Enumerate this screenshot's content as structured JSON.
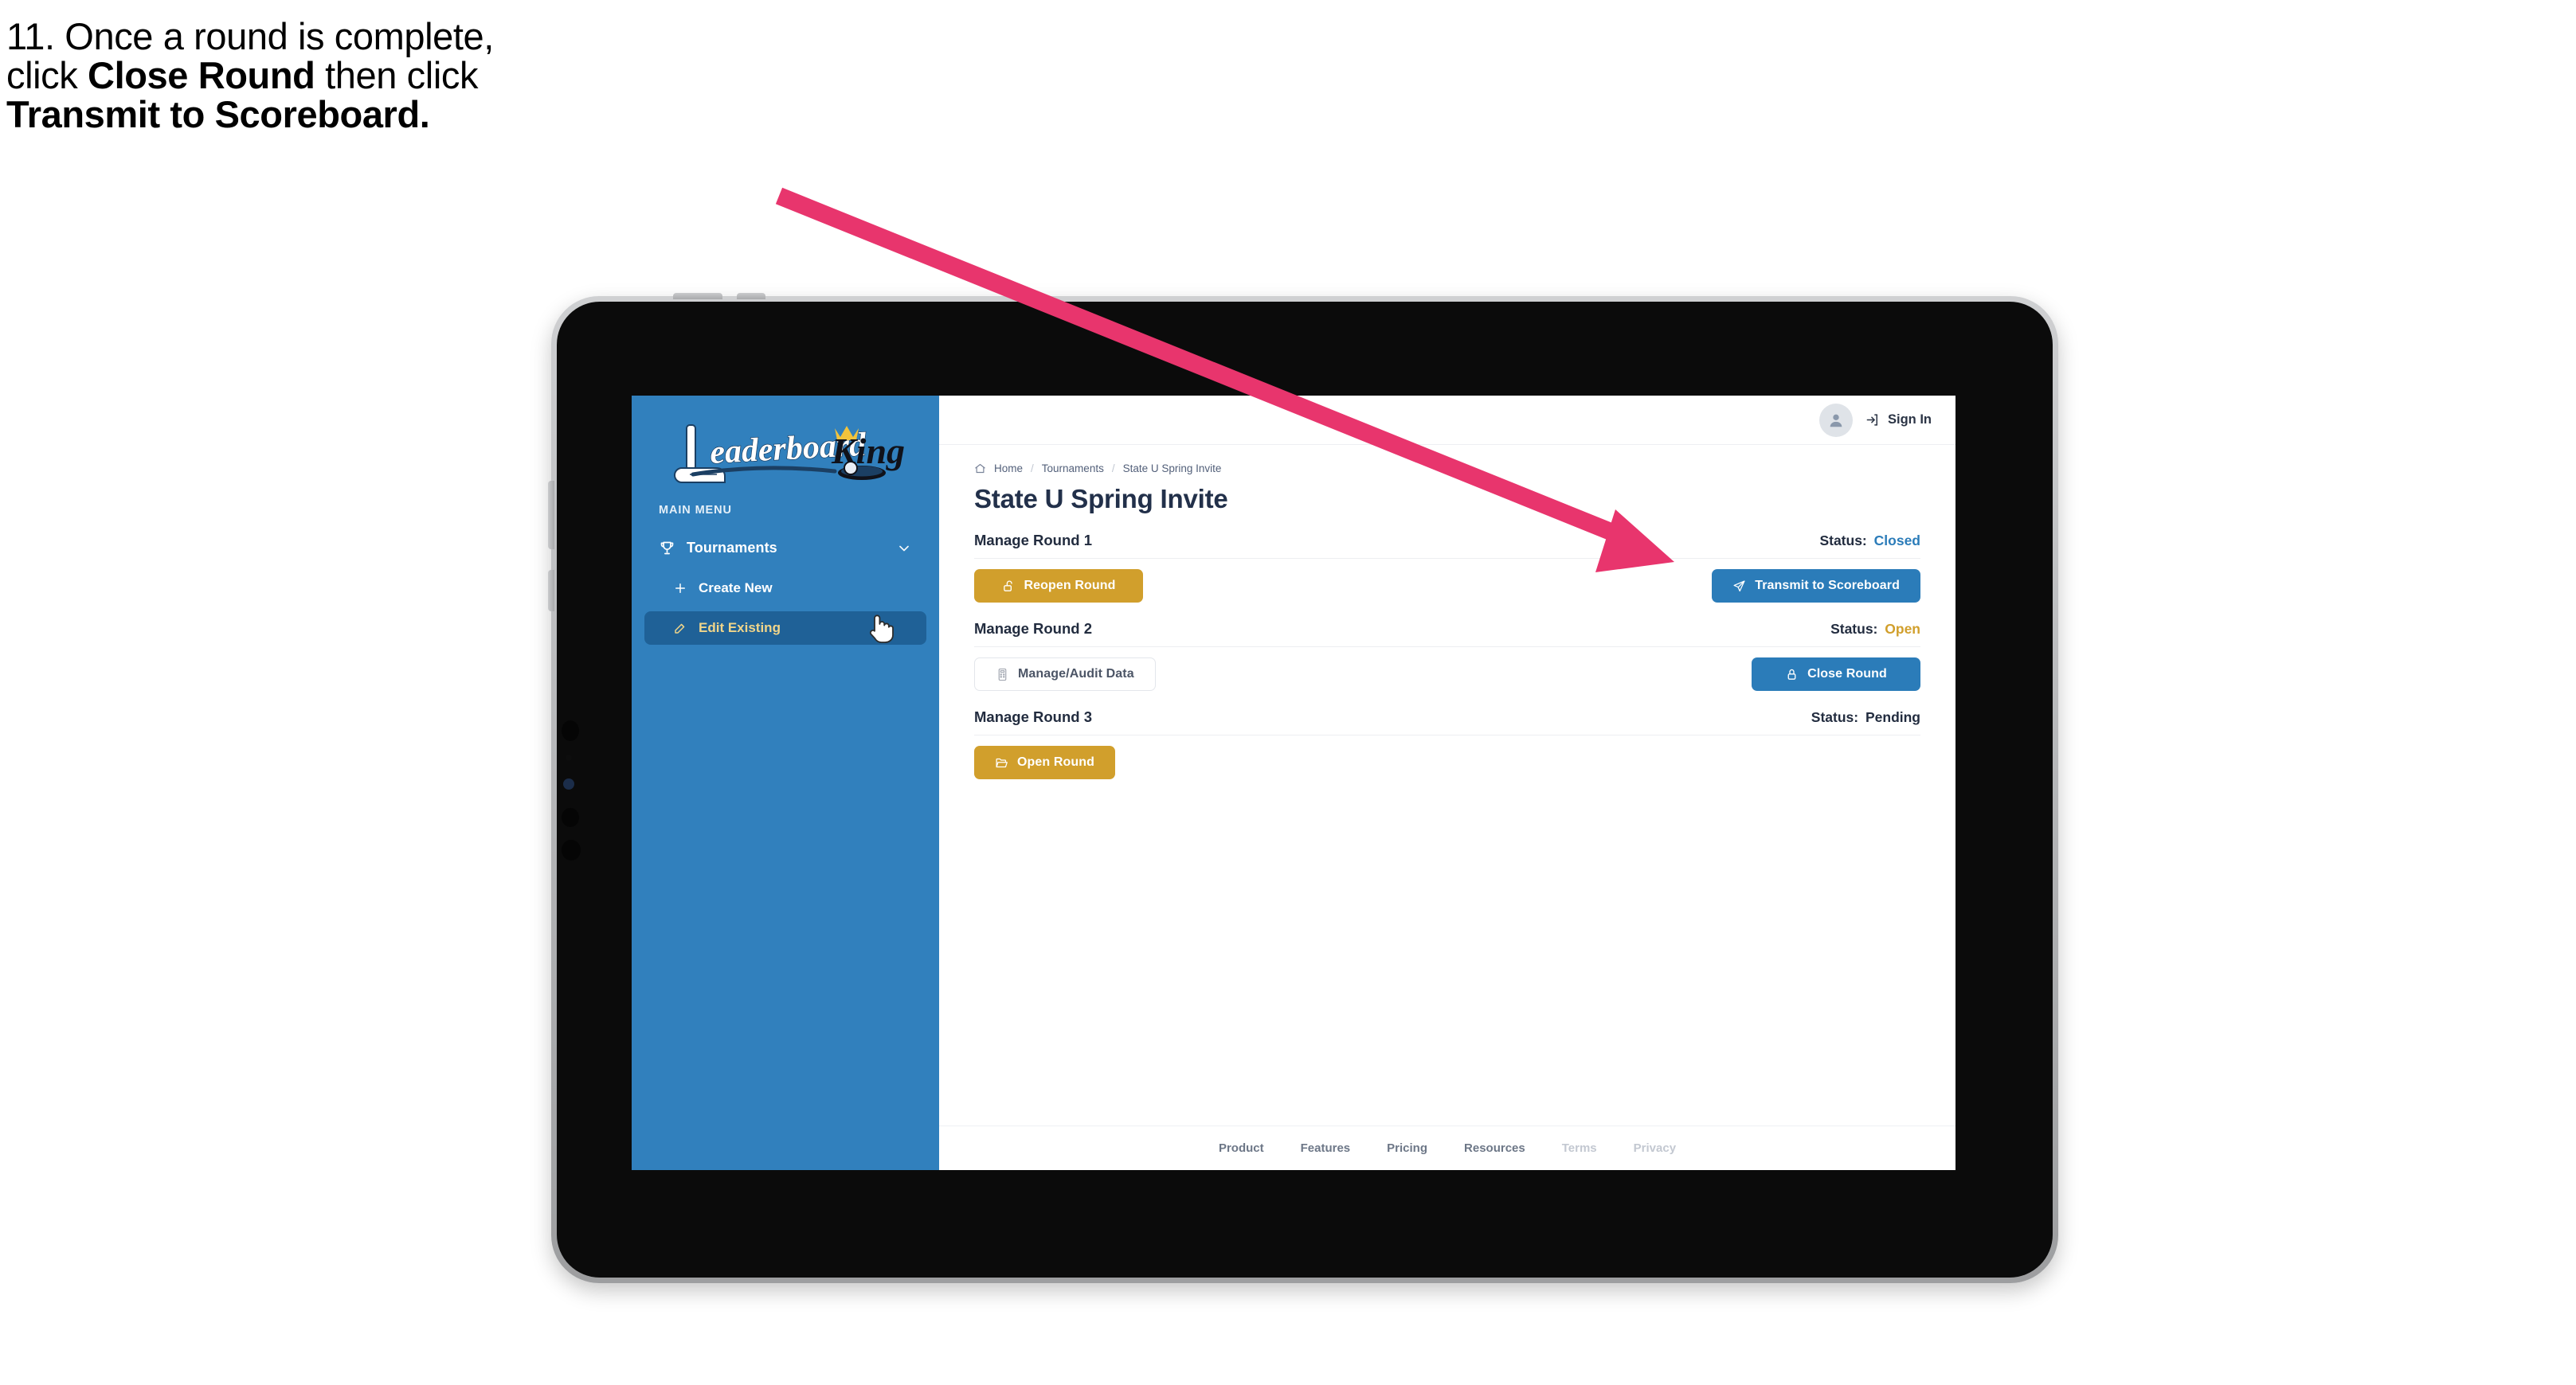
{
  "caption": {
    "line1": "11. Once a round is complete,",
    "line2_a": "click ",
    "line2_b": "Close Round",
    "line2_c": " then click",
    "line3": "Transmit to Scoreboard."
  },
  "annotation": {
    "arrow_color": "#E8356D",
    "points_to": "Transmit to Scoreboard"
  },
  "sidebar": {
    "logo_primary": "Leaderboard",
    "logo_secondary": "King",
    "section_label": "MAIN MENU",
    "items": [
      {
        "label": "Tournaments",
        "icon": "trophy-icon",
        "expand_icon": "chevron-down-icon",
        "active": false
      },
      {
        "label": "Create New",
        "icon": "plus-icon",
        "active": false
      },
      {
        "label": "Edit Existing",
        "icon": "edit-pencil-icon",
        "active": true
      }
    ],
    "bg_color": "#3180BD",
    "active_bg_color": "#1F6197",
    "active_text_color": "#F0D58A"
  },
  "topbar": {
    "avatar_icon": "user-avatar-icon",
    "signin_icon": "sign-in-arrow-icon",
    "signin_label": "Sign In"
  },
  "breadcrumb": {
    "home_icon": "home-icon",
    "items": [
      "Home",
      "Tournaments",
      "State U Spring Invite"
    ],
    "separator": "/"
  },
  "page": {
    "title": "State U Spring Invite"
  },
  "rounds": [
    {
      "name": "Manage Round 1",
      "status_label": "Status:",
      "status_value": "Closed",
      "status_color": "#2B7CB9",
      "left_button": {
        "label": "Reopen Round",
        "icon": "unlock-icon",
        "style": "gold"
      },
      "right_button": {
        "label": "Transmit to Scoreboard",
        "icon": "paper-plane-icon",
        "style": "blue"
      }
    },
    {
      "name": "Manage Round 2",
      "status_label": "Status:",
      "status_value": "Open",
      "status_color": "#D19F2C",
      "left_button": {
        "label": "Manage/Audit Data",
        "icon": "calculator-icon",
        "style": "ghost"
      },
      "right_button": {
        "label": "Close Round",
        "icon": "lock-icon",
        "style": "blue"
      }
    },
    {
      "name": "Manage Round 3",
      "status_label": "Status:",
      "status_value": "Pending",
      "status_color": "#222C3F",
      "left_button": {
        "label": "Open Round",
        "icon": "folder-open-icon",
        "style": "gold"
      },
      "right_button": null
    }
  ],
  "footer": {
    "links": [
      {
        "label": "Product",
        "muted": false
      },
      {
        "label": "Features",
        "muted": false
      },
      {
        "label": "Pricing",
        "muted": false
      },
      {
        "label": "Resources",
        "muted": false
      },
      {
        "label": "Terms",
        "muted": true
      },
      {
        "label": "Privacy",
        "muted": true
      }
    ]
  },
  "cursor": {
    "type": "pointing-hand-cursor"
  }
}
